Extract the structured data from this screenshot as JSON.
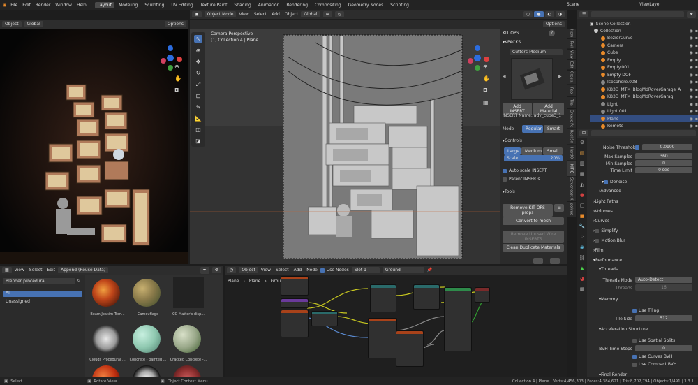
{
  "topbar": {
    "menus": [
      "File",
      "Edit",
      "Render",
      "Window",
      "Help"
    ],
    "workspaces": [
      "Layout",
      "Modeling",
      "Sculpting",
      "UV Editing",
      "Texture Paint",
      "Shading",
      "Animation",
      "Rendering",
      "Compositing",
      "Geometry Nodes",
      "Scripting"
    ],
    "scene_label": "Scene",
    "viewlayer_label": "ViewLayer"
  },
  "left_viewport": {
    "mode": "Object",
    "orientation": "Global",
    "options": "Options"
  },
  "main_viewport": {
    "mode": "Object Mode",
    "menus": [
      "View",
      "Select",
      "Add",
      "Object"
    ],
    "orientation": "Global",
    "overlay_title": "Camera Perspective",
    "overlay_subtitle": "(1) Collection 4 | Plane",
    "options": "Options"
  },
  "kitops": {
    "title": "KIT OPS",
    "kpacks": "KPACKS",
    "pack_select": "Cutters-Medium",
    "add_insert": "Add INSERT",
    "add_material": "Add Material",
    "insert_name": "INSERT Name: adv_cube3_1",
    "mode_label": "Mode",
    "mode_regular": "Regular",
    "mode_smart": "Smart",
    "controls": "Controls",
    "large": "Large",
    "medium": "Medium",
    "small": "Small",
    "scale_label": "Scale",
    "scale_value": "20%",
    "auto_scale": "Auto scale INSERT",
    "parent_inserts": "Parent INSERTs",
    "tools": "Tools",
    "remove_props": "Remove KIT OPS props",
    "convert_mesh": "Convert to mesh",
    "remove_unused": "Remove Unused Wire INSERTS",
    "clean_materials": "Clean Duplicate Materials"
  },
  "side_tabs": [
    "Item",
    "Tool",
    "View",
    "Edit",
    "Create",
    "Pap",
    "Tila",
    "Grease Pe",
    "Real Sn",
    "HardO",
    "KIT O",
    "Screencast K",
    "polygo"
  ],
  "outliner": {
    "title": "Scene Collection",
    "items": [
      {
        "name": "Collection",
        "color": "#cccccc"
      },
      {
        "name": "BezierCurve",
        "color": "#e88a2a"
      },
      {
        "name": "Camera",
        "color": "#e88a2a"
      },
      {
        "name": "Cube",
        "color": "#e88a2a"
      },
      {
        "name": "Empty",
        "color": "#e88a2a"
      },
      {
        "name": "Empty.001",
        "color": "#e88a2a"
      },
      {
        "name": "Empty DOF",
        "color": "#e88a2a"
      },
      {
        "name": "Icosphere.008",
        "color": "#888888"
      },
      {
        "name": "KB3D_MTM_BldgMdRoverGarage_A",
        "color": "#e88a2a"
      },
      {
        "name": "KB3D_MTM_BldgMdRoverGarag",
        "color": "#e88a2a"
      },
      {
        "name": "Light",
        "color": "#888888"
      },
      {
        "name": "Light.001",
        "color": "#888888"
      },
      {
        "name": "Plane",
        "color": "#e88a2a"
      },
      {
        "name": "Remote",
        "color": "#e88a2a"
      }
    ]
  },
  "properties": {
    "noise_threshold_label": "Noise Threshold",
    "noise_threshold_value": "0.0100",
    "max_samples_label": "Max Samples",
    "max_samples_value": "360",
    "min_samples_label": "Min Samples",
    "min_samples_value": "0",
    "time_limit_label": "Time Limit",
    "time_limit_value": "0 sec",
    "denoise": "Denoise",
    "advanced": "Advanced",
    "light_paths": "Light Paths",
    "volumes": "Volumes",
    "curves": "Curves",
    "simplify": "Simplify",
    "motion_blur": "Motion Blur",
    "film": "Film",
    "performance": "Performance",
    "threads": "Threads",
    "threads_mode_label": "Threads Mode",
    "threads_mode_value": "Auto-Detect",
    "threads_label": "Threads",
    "threads_value": "16",
    "memory": "Memory",
    "use_tiling": "Use Tiling",
    "tile_size_label": "Tile Size",
    "tile_size_value": "512",
    "accel": "Acceleration Structure",
    "spatial_splits": "Use Spatial Splits",
    "bvh_steps_label": "BVH Time Steps",
    "bvh_steps_value": "0",
    "curves_bvh": "Use Curves BVH",
    "compact_bvh": "Use Compact BVH",
    "final_render": "Final Render"
  },
  "asset_browser": {
    "menus": [
      "View",
      "Select",
      "Edit"
    ],
    "append": "Append (Reuse Data)",
    "library": "Blender procedural",
    "catalog_all": "All",
    "catalog_unassigned": "Unassigned",
    "assets": [
      {
        "name": "Beam Joakim Tom...",
        "color": "#c0461a"
      },
      {
        "name": "Camouflage",
        "color": "#8a7a4a"
      },
      {
        "name": "CG Matter's disp...",
        "color": "#2a2a2a"
      },
      {
        "name": "Clouds Procedural ...",
        "color": "#d8d8d8"
      },
      {
        "name": "Concrete - painted ...",
        "color": "#8fc8b0"
      },
      {
        "name": "Cracked Concrete -...",
        "color": "#9aa88a"
      }
    ]
  },
  "node_editor": {
    "type": "Object",
    "menus": [
      "View",
      "Select",
      "Add",
      "Node"
    ],
    "use_nodes": "Use Nodes",
    "slot": "Slot 1",
    "material": "Ground",
    "breadcrumb": [
      "Plane",
      "Plane",
      "Ground"
    ]
  },
  "statusbar": {
    "select": "Select",
    "rotate": "Rotate View",
    "context": "Object Context Menu",
    "stats": "Collection 4 | Plane | Verts:4,456,303 | Faces:4,384,621 | Tris:8,702,794 | Objects:1/491 | 3.3.1"
  }
}
